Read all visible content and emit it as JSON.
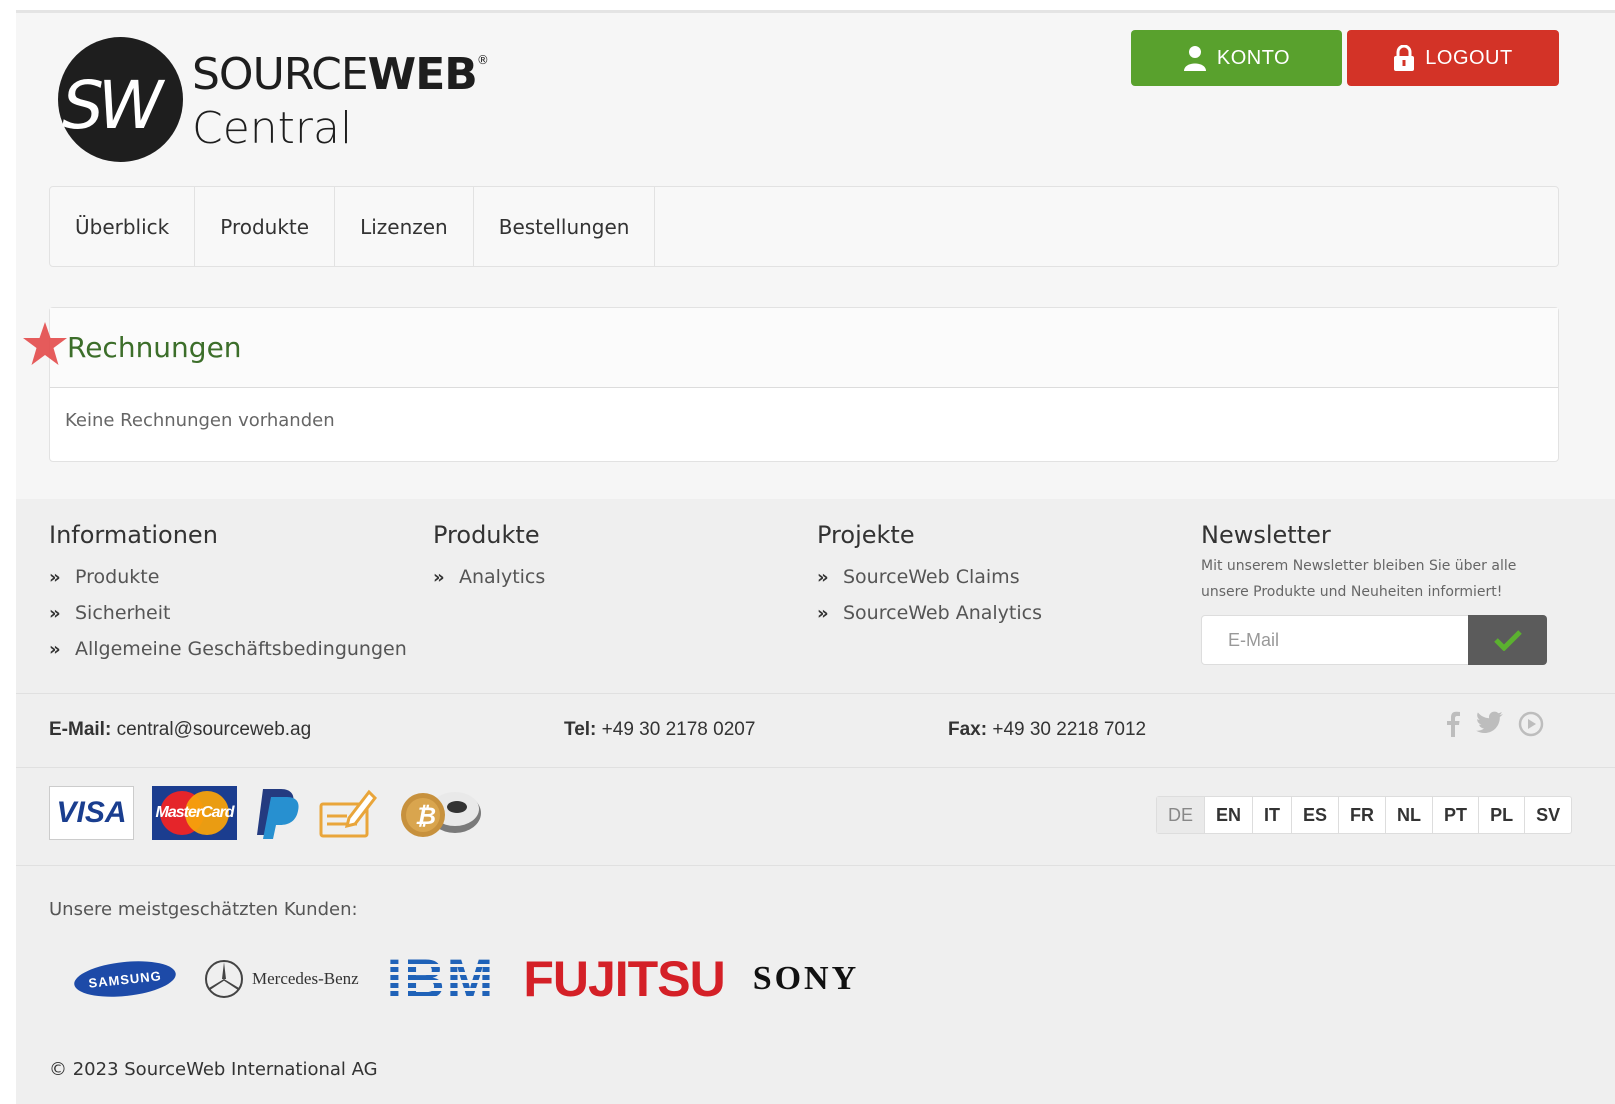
{
  "brand": {
    "monogram": "SW",
    "name_light": "SOURCE",
    "name_bold": "WEB",
    "registered": "®",
    "subtitle": "Central"
  },
  "header": {
    "konto_label": "KONTO",
    "logout_label": "LOGOUT",
    "konto_color": "#59a12d",
    "logout_color": "#d33327"
  },
  "nav": {
    "items": [
      "Überblick",
      "Produkte",
      "Lizenzen",
      "Bestellungen"
    ]
  },
  "invoices": {
    "title": "Rechnungen",
    "empty_text": "Keine Rechnungen vorhanden",
    "title_color": "#3c6e2a"
  },
  "footer": {
    "informationen": {
      "title": "Informationen",
      "links": [
        "Produkte",
        "Sicherheit",
        "Allgemeine Geschäftsbedingungen"
      ]
    },
    "produkte": {
      "title": "Produkte",
      "links": [
        "Analytics"
      ]
    },
    "projekte": {
      "title": "Projekte",
      "links": [
        "SourceWeb Claims",
        "SourceWeb Analytics"
      ]
    },
    "newsletter": {
      "title": "Newsletter",
      "description": "Mit unserem Newsletter bleiben Sie über alle unsere Produkte und Neuheiten informiert!",
      "email_placeholder": "E-Mail"
    },
    "contact": {
      "email_label": "E-Mail:",
      "email_value": "central@sourceweb.ag",
      "tel_label": "Tel:",
      "tel_value": "+49 30 2178 0207",
      "fax_label": "Fax:",
      "fax_value": "+49 30 2218 7012"
    },
    "social_icons": [
      "facebook-icon",
      "twitter-icon",
      "youtube-icon"
    ],
    "payments": {
      "visa": "VISA",
      "mastercard": "MasterCard",
      "icons": [
        "visa-logo",
        "mastercard-logo",
        "paypal-logo",
        "invoice-icon",
        "bitcoin-icon"
      ]
    },
    "languages": [
      "DE",
      "EN",
      "IT",
      "ES",
      "FR",
      "NL",
      "PT",
      "PL",
      "SV"
    ],
    "active_language": "DE",
    "clients_label": "Unsere meistgeschätzten Kunden:",
    "clients": {
      "samsung": "SAMSUNG",
      "mercedes": "Mercedes-Benz",
      "ibm": "IBM",
      "fujitsu": "FUJITSU",
      "sony": "SONY"
    },
    "copyright": "© 2023 SourceWeb International AG"
  }
}
